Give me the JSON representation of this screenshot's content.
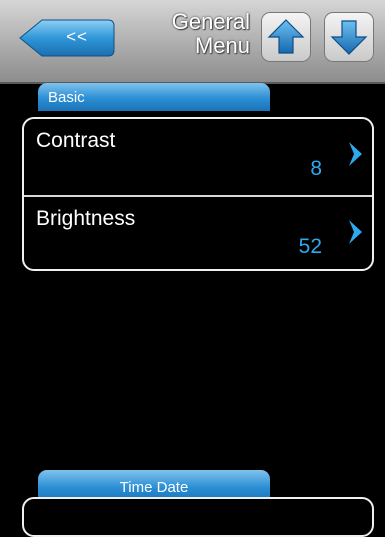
{
  "header": {
    "back_label": "<<",
    "title_line1": "General",
    "title_line2": "Menu",
    "up_icon": "arrow-up-icon",
    "down_icon": "arrow-down-icon"
  },
  "tabs": {
    "basic": "Basic",
    "time_date": "Time Date"
  },
  "settings": [
    {
      "label": "Contrast",
      "value": "8"
    },
    {
      "label": "Brightness",
      "value": "52"
    }
  ],
  "colors": {
    "accent_blue": "#2b8ed4",
    "value_blue": "#2ea8ef",
    "background": "#000000"
  }
}
